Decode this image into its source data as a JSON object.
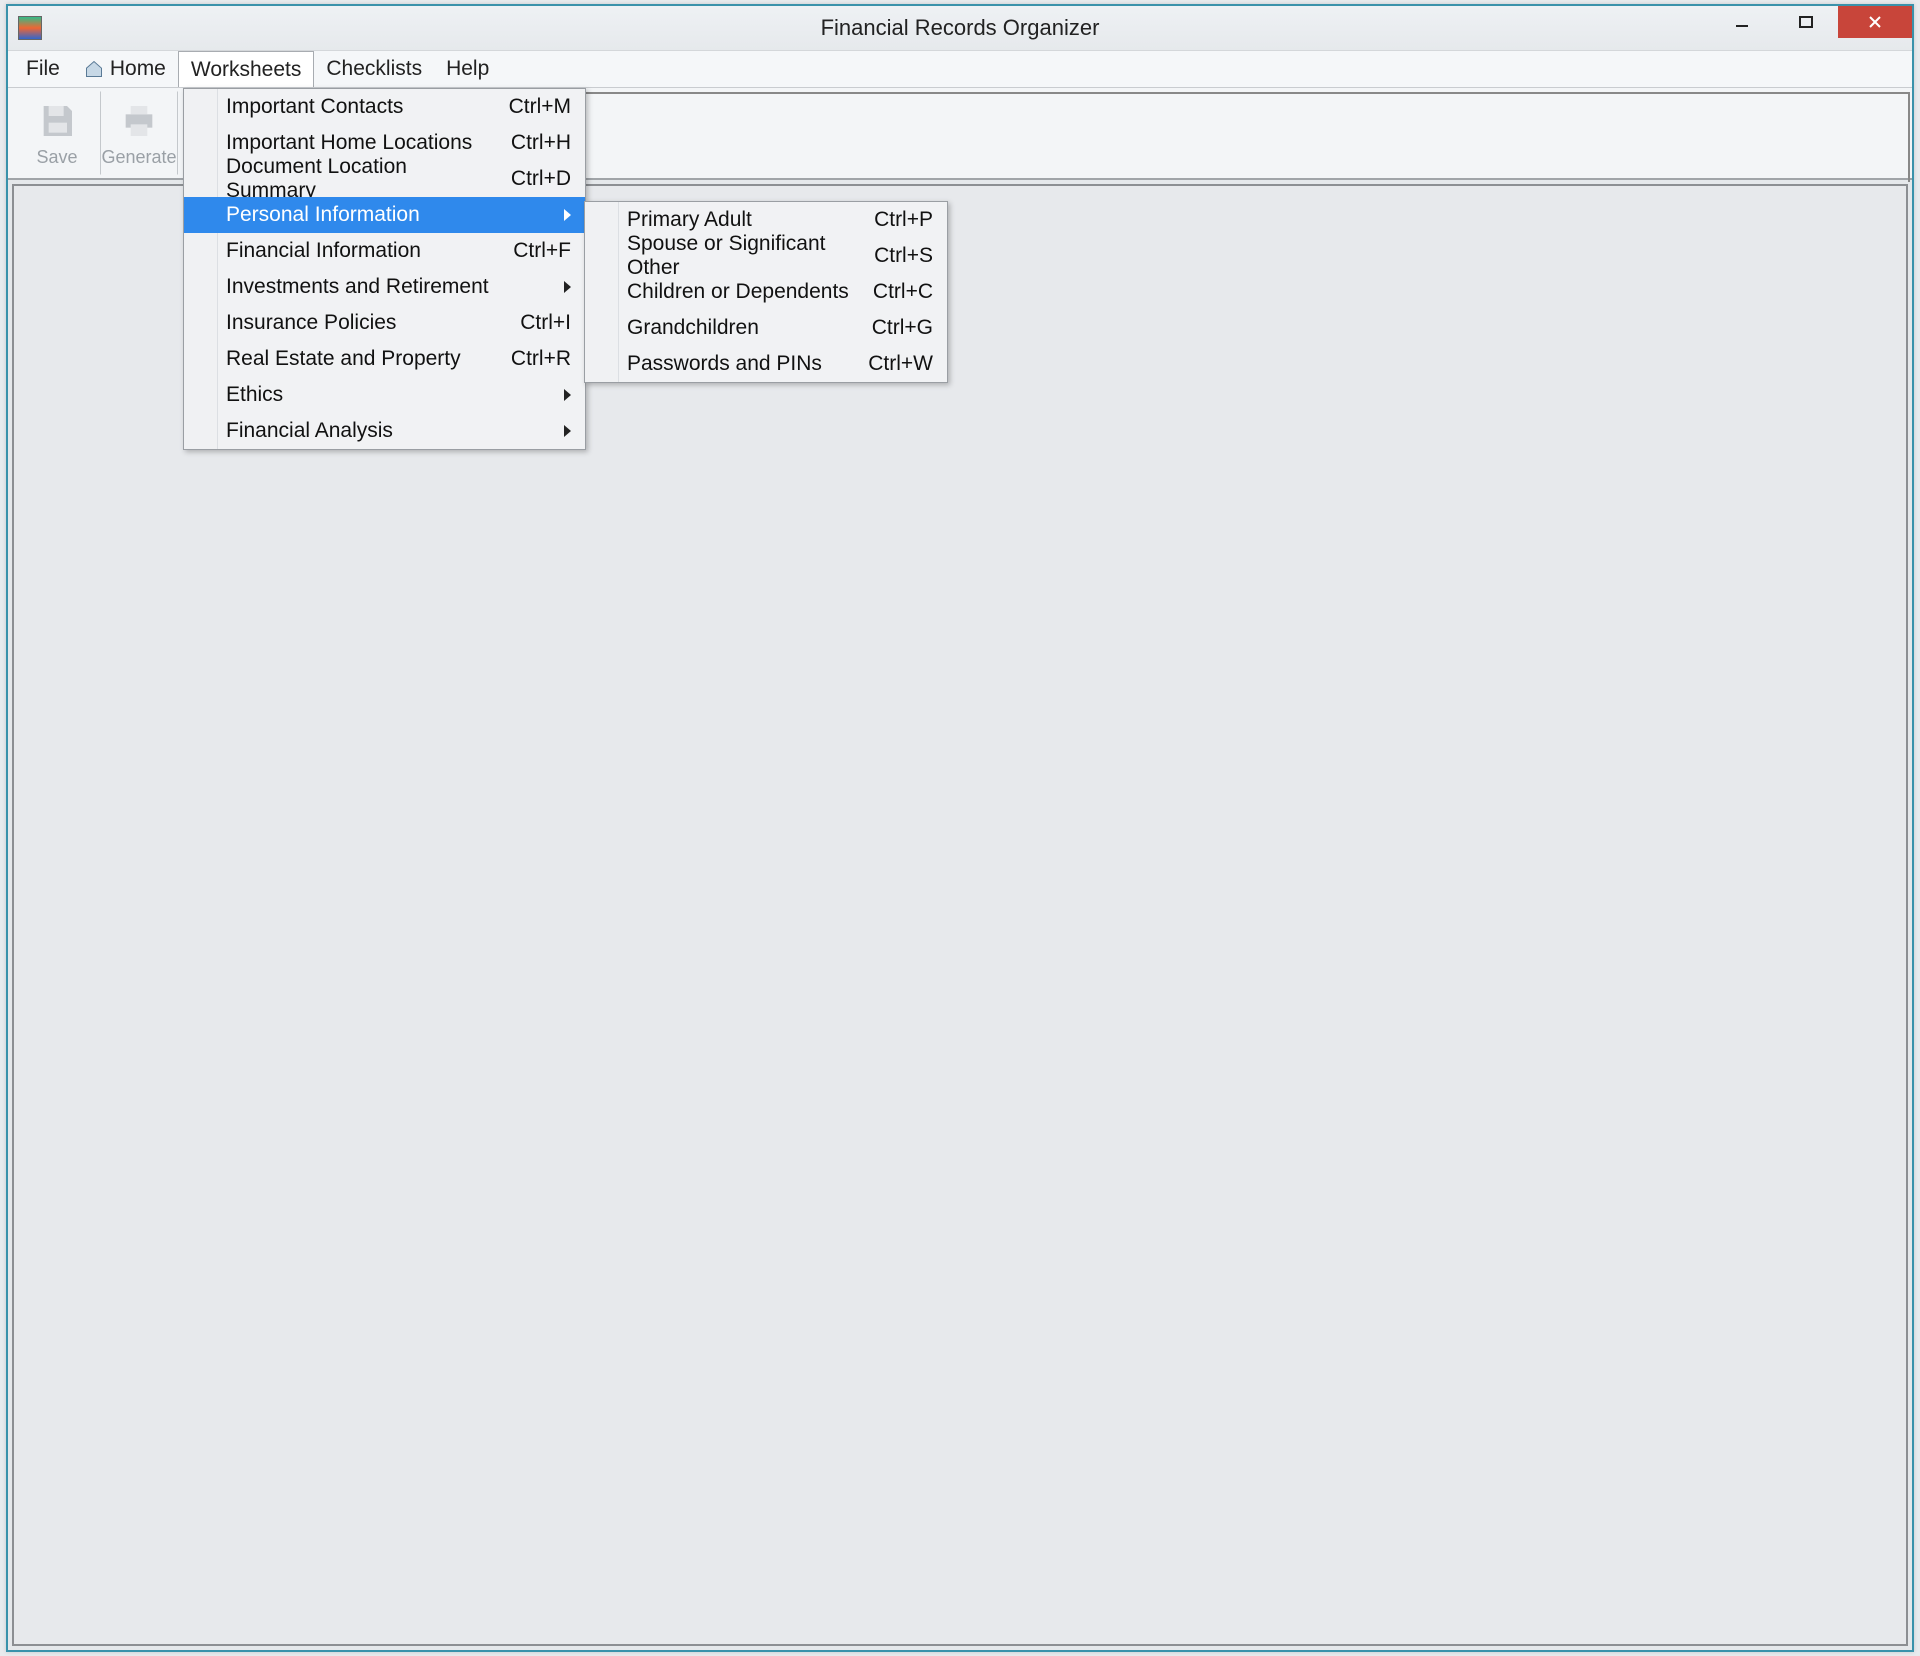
{
  "window": {
    "title": "Financial Records Organizer"
  },
  "menubar": {
    "file": "File",
    "home": "Home",
    "worksheets": "Worksheets",
    "checklists": "Checklists",
    "help": "Help"
  },
  "toolbar": {
    "save": "Save",
    "generate": "Generate"
  },
  "worksheets_menu": {
    "important_contacts": {
      "label": "Important Contacts",
      "shortcut": "Ctrl+M"
    },
    "important_home_locations": {
      "label": "Important Home Locations",
      "shortcut": "Ctrl+H"
    },
    "document_location_summary": {
      "label": "Document Location Summary",
      "shortcut": "Ctrl+D"
    },
    "personal_information": {
      "label": "Personal Information"
    },
    "financial_information": {
      "label": "Financial Information",
      "shortcut": "Ctrl+F"
    },
    "investments_and_retirement": {
      "label": "Investments and Retirement"
    },
    "insurance_policies": {
      "label": "Insurance Policies",
      "shortcut": "Ctrl+I"
    },
    "real_estate_and_property": {
      "label": "Real Estate and Property",
      "shortcut": "Ctrl+R"
    },
    "ethics": {
      "label": "Ethics"
    },
    "financial_analysis": {
      "label": "Financial Analysis"
    }
  },
  "personal_info_submenu": {
    "primary_adult": {
      "label": "Primary Adult",
      "shortcut": "Ctrl+P"
    },
    "spouse": {
      "label": "Spouse or Significant Other",
      "shortcut": "Ctrl+S"
    },
    "children": {
      "label": "Children or Dependents",
      "shortcut": "Ctrl+C"
    },
    "grandchildren": {
      "label": "Grandchildren",
      "shortcut": "Ctrl+G"
    },
    "passwords": {
      "label": "Passwords and PINs",
      "shortcut": "Ctrl+W"
    }
  }
}
